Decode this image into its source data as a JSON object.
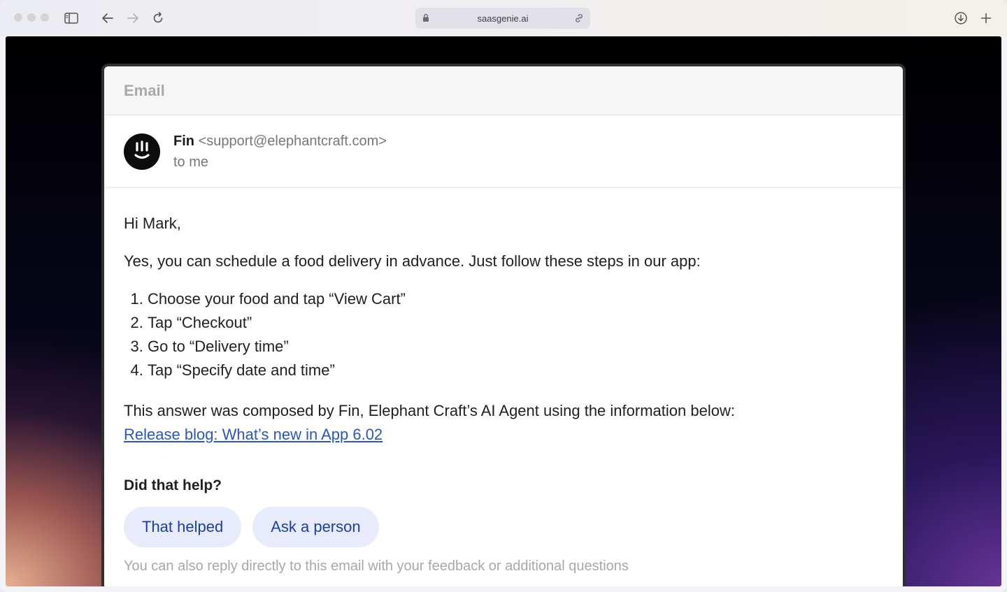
{
  "browser": {
    "url": "saasgenie.ai",
    "icons": {
      "sidebar": "sidebar-icon",
      "back": "arrow-left-icon",
      "forward": "arrow-right-icon",
      "reload": "reload-icon",
      "lock": "lock-icon",
      "share_link": "link-icon",
      "downloads": "download-icon",
      "new_tab": "plus-icon"
    }
  },
  "email": {
    "header_title": "Email",
    "sender": {
      "name": "Fin",
      "address": "<support@elephantcraft.com>",
      "recipient": "to me"
    },
    "greeting": "Hi Mark,",
    "intro": "Yes, you can schedule a food delivery in advance. Just follow these steps in our app:",
    "steps": [
      "Choose your food and tap “View Cart”",
      "Tap “Checkout”",
      "Go to “Delivery time”",
      "Tap “Specify date and time”"
    ],
    "composed_note": "This answer was composed by Fin, Elephant Craft’s AI Agent using the information below:",
    "source_link": "Release blog: What’s new in App 6.02",
    "feedback": {
      "question": "Did that help?",
      "helped_label": "That helped",
      "ask_person_label": "Ask a person",
      "note": "You can also reply directly to this email with your feedback or additional questions"
    }
  },
  "colors": {
    "link": "#2a55c8",
    "pill_bg": "#e7ebfc",
    "pill_text": "#1d3fa3",
    "avatar_bg": "#0c0c0c"
  }
}
